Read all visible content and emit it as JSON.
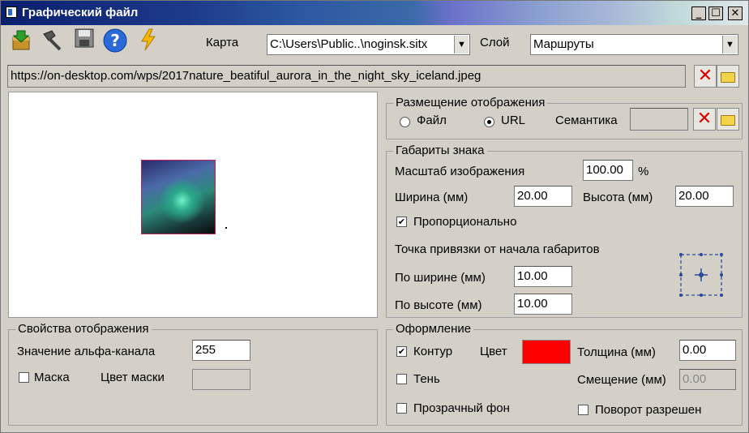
{
  "window": {
    "title": "Графический файл",
    "min": "_",
    "max": "☐",
    "close": "✕"
  },
  "toolbar": {
    "icons": [
      "import-icon",
      "hammer-icon",
      "save-icon",
      "help-icon",
      "lightning-icon"
    ]
  },
  "map": {
    "label": "Карта",
    "value": "C:\\Users\\Public..\\noginsk.sitx",
    "arrow": "▼"
  },
  "layer": {
    "label": "Слой",
    "value": "Маршруты",
    "arrow": "▼"
  },
  "url": {
    "value": "https://on-desktop.com/wps/2017nature_beatiful_aurora_in_the_night_sky_iceland.jpeg"
  },
  "placement": {
    "title": "Размещение отображения",
    "file_label": "Файл",
    "url_label": "URL",
    "url_selected": true,
    "semantic_label": "Семантика",
    "semantic_value": ""
  },
  "dimensions": {
    "title": "Габариты знака",
    "scale_label": "Масштаб изображения",
    "scale_value": "100.00",
    "scale_unit": "%",
    "width_label": "Ширина (мм)",
    "width_value": "20.00",
    "height_label": "Высота (мм)",
    "height_value": "20.00",
    "proportional_label": "Пропорционально",
    "proportional_checked": true,
    "anchor_label": "Точка привязки от начала габаритов",
    "anchor_x_label": "По ширине (мм)",
    "anchor_x_value": "10.00",
    "anchor_y_label": "По высоте (мм)",
    "anchor_y_value": "10.00"
  },
  "display_props": {
    "title": "Свойства отображения",
    "alpha_label": "Значение альфа-канала",
    "alpha_value": "255",
    "mask_label": "Маска",
    "mask_checked": false,
    "mask_color_label": "Цвет маски"
  },
  "design": {
    "title": "Оформление",
    "contour_label": "Контур",
    "contour_checked": true,
    "color_label": "Цвет",
    "color_value": "#ff0000",
    "thickness_label": "Толщина (мм)",
    "thickness_value": "0.00",
    "shadow_label": "Тень",
    "shadow_checked": false,
    "offset_label": "Смещение (мм)",
    "offset_value": "0.00",
    "transparent_label": "Прозрачный фон",
    "transparent_checked": false,
    "rotation_label": "Поворот разрешен",
    "rotation_checked": false
  },
  "check_mark": "✔",
  "colors": {
    "accent_red": "#ff0000",
    "title_bar_start": "#0a1f6e"
  }
}
